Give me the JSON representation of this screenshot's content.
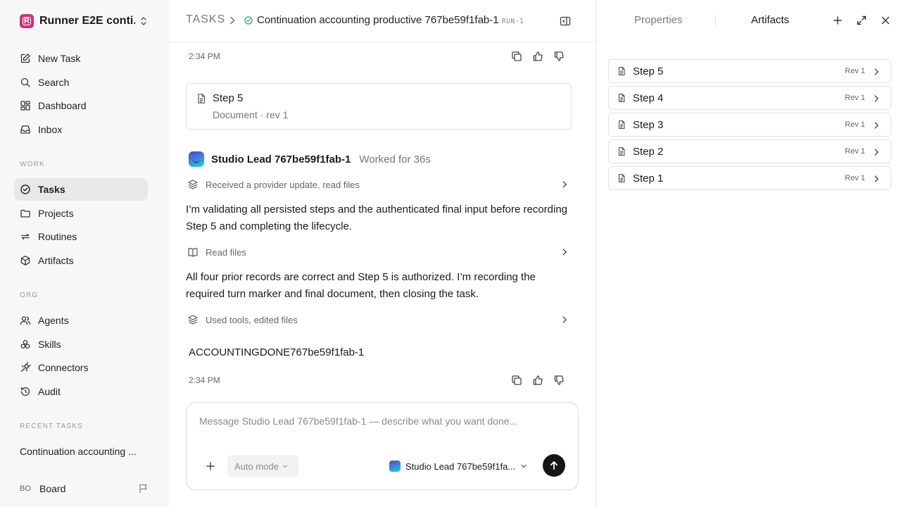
{
  "sidebar": {
    "workspace_name": "Runner E2E conti...",
    "workspace_logo_letter": "R",
    "nav": [
      {
        "label": "New Task",
        "icon": "edit-icon"
      },
      {
        "label": "Search",
        "icon": "search-icon"
      },
      {
        "label": "Dashboard",
        "icon": "dashboard-icon"
      },
      {
        "label": "Inbox",
        "icon": "inbox-icon"
      }
    ],
    "work_label": "WORK",
    "work": [
      {
        "label": "Tasks",
        "icon": "check-circle-icon",
        "active": true
      },
      {
        "label": "Projects",
        "icon": "folder-icon"
      },
      {
        "label": "Routines",
        "icon": "repeat-icon"
      },
      {
        "label": "Artifacts",
        "icon": "box-icon"
      }
    ],
    "org_label": "ORG",
    "org": [
      {
        "label": "Agents",
        "icon": "users-icon"
      },
      {
        "label": "Skills",
        "icon": "skills-icon"
      },
      {
        "label": "Connectors",
        "icon": "plug-icon"
      },
      {
        "label": "Audit",
        "icon": "history-icon"
      }
    ],
    "recent_label": "RECENT TASKS",
    "recent_task": "Continuation accounting ...",
    "user_initials": "BO",
    "user_name": "Board"
  },
  "header": {
    "root": "TASKS",
    "title": "Continuation accounting productive 767be59f1fab-1",
    "run_id": "RUN-1",
    "status_color": "#22a55b"
  },
  "thread": {
    "timestamp_top": "2:34 PM",
    "artifact_card": {
      "title": "Step 5",
      "subtitle": "Document · rev 1"
    },
    "agent_name": "Studio Lead 767be59f1fab-1",
    "agent_meta": "Worked for 36s",
    "step_1": "Received a provider update, read files",
    "message_1": "I’m validating all persisted steps and the authenticated final input before recording Step 5 and completing the lifecycle.",
    "step_2": "Read files",
    "message_2": "All four prior records are correct and Step 5 is authorized. I’m recording the required turn marker and final document, then closing the task.",
    "step_3": "Used tools, edited files",
    "final_output": "ACCOUNTINGDONE767be59f1fab-1",
    "timestamp_bottom": "2:34 PM"
  },
  "composer": {
    "placeholder": "Message Studio Lead 767be59f1fab-1 — describe what you want done...",
    "mode_label": "Auto mode",
    "agent_label": "Studio Lead 767be59f1fa..."
  },
  "right_panel": {
    "tab_properties": "Properties",
    "tab_artifacts": "Artifacts",
    "artifacts": [
      {
        "title": "Step 5",
        "rev": "Rev 1"
      },
      {
        "title": "Step 4",
        "rev": "Rev 1"
      },
      {
        "title": "Step 3",
        "rev": "Rev 1"
      },
      {
        "title": "Step 2",
        "rev": "Rev 1"
      },
      {
        "title": "Step 1",
        "rev": "Rev 1"
      }
    ]
  }
}
